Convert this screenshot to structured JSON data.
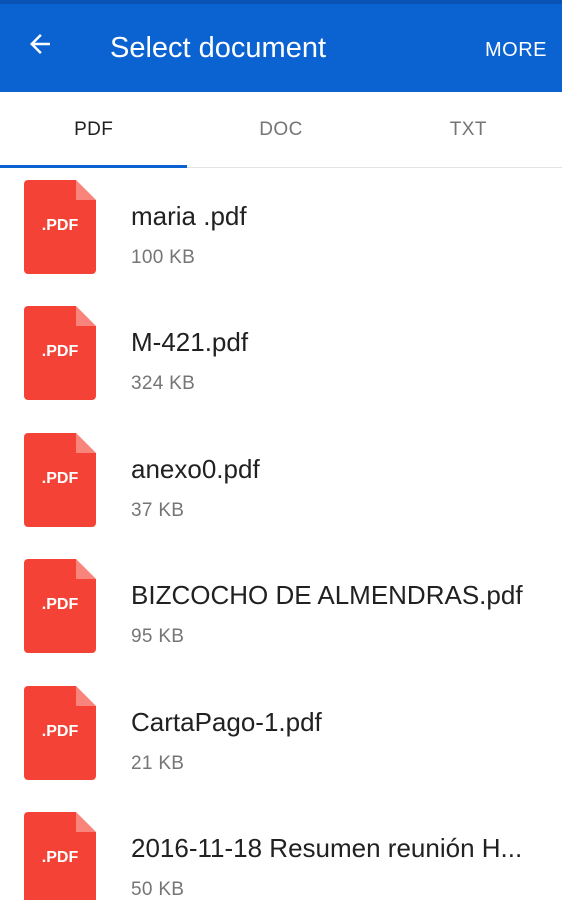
{
  "appbar": {
    "title": "Select document",
    "more_label": "MORE",
    "back_icon": "arrow-left-icon",
    "color": "#0b63d1"
  },
  "tabs": [
    {
      "label": "PDF",
      "active": true
    },
    {
      "label": "DOC",
      "active": false
    },
    {
      "label": "TXT",
      "active": false
    }
  ],
  "file_icon": {
    "name": "pdf-file-icon",
    "label": ".PDF",
    "color": "#f44336"
  },
  "files": [
    {
      "name": "maria .pdf",
      "size": "100 KB"
    },
    {
      "name": "M-421.pdf",
      "size": "324 KB"
    },
    {
      "name": "anexo0.pdf",
      "size": "37 KB"
    },
    {
      "name": "BIZCOCHO DE ALMENDRAS.pdf",
      "size": "95 KB"
    },
    {
      "name": "CartaPago-1.pdf",
      "size": "21 KB"
    },
    {
      "name": "2016-11-18 Resumen reunión H...",
      "size": "50 KB"
    }
  ]
}
